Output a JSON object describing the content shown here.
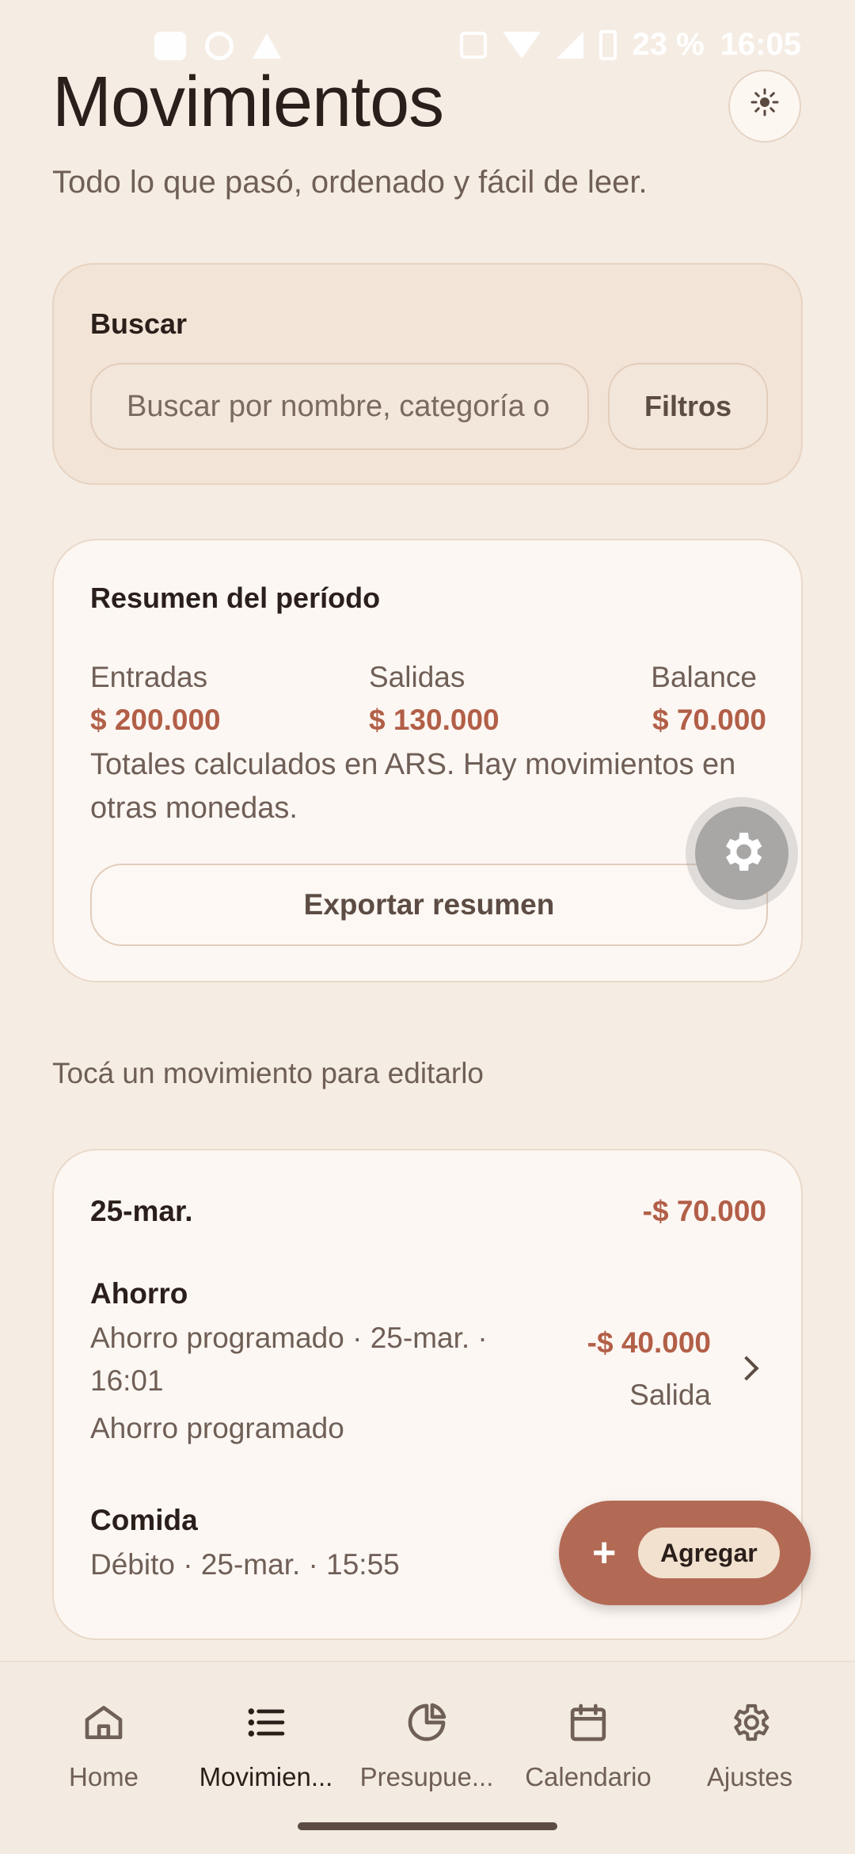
{
  "status_bar": {
    "battery": "23 %",
    "time": "16:05"
  },
  "header": {
    "title": "Movimientos",
    "subtitle": "Todo lo que pasó, ordenado y fácil de leer.",
    "theme_icon": "sun-icon"
  },
  "search": {
    "label": "Buscar",
    "placeholder": "Buscar por nombre, categoría o",
    "filters_label": "Filtros"
  },
  "summary": {
    "title": "Resumen del período",
    "entradas_label": "Entradas",
    "entradas_value": "$ 200.000",
    "salidas_label": "Salidas",
    "salidas_value": "$ 130.000",
    "balance_label": "Balance",
    "balance_value": "$ 70.000",
    "note": "Totales calculados en ARS. Hay movimientos en otras monedas.",
    "export_label": "Exportar resumen"
  },
  "hint": "Tocá un movimiento para editarlo",
  "day_group": {
    "date": "25-mar.",
    "total": "-$ 70.000",
    "transactions": [
      {
        "name": "Ahorro",
        "meta": "Ahorro programado · 25-mar. · 16:01",
        "note": "Ahorro programado",
        "amount": "-$ 40.000",
        "type": "Salida"
      },
      {
        "name": "Comida",
        "meta": "Débito · 25-mar. · 15:55"
      }
    ]
  },
  "fab": {
    "label": "Agregar",
    "icon": "plus-icon"
  },
  "nav": {
    "items": [
      {
        "label": "Home",
        "icon": "home-icon"
      },
      {
        "label": "Movimien...",
        "icon": "list-icon"
      },
      {
        "label": "Presupue...",
        "icon": "pie-chart-icon"
      },
      {
        "label": "Calendario",
        "icon": "calendar-icon"
      },
      {
        "label": "Ajustes",
        "icon": "gear-icon"
      }
    ],
    "active_index": 1
  },
  "colors": {
    "background": "#f5ede4",
    "accent": "#b36a55",
    "amount_negative": "#b25f48"
  }
}
